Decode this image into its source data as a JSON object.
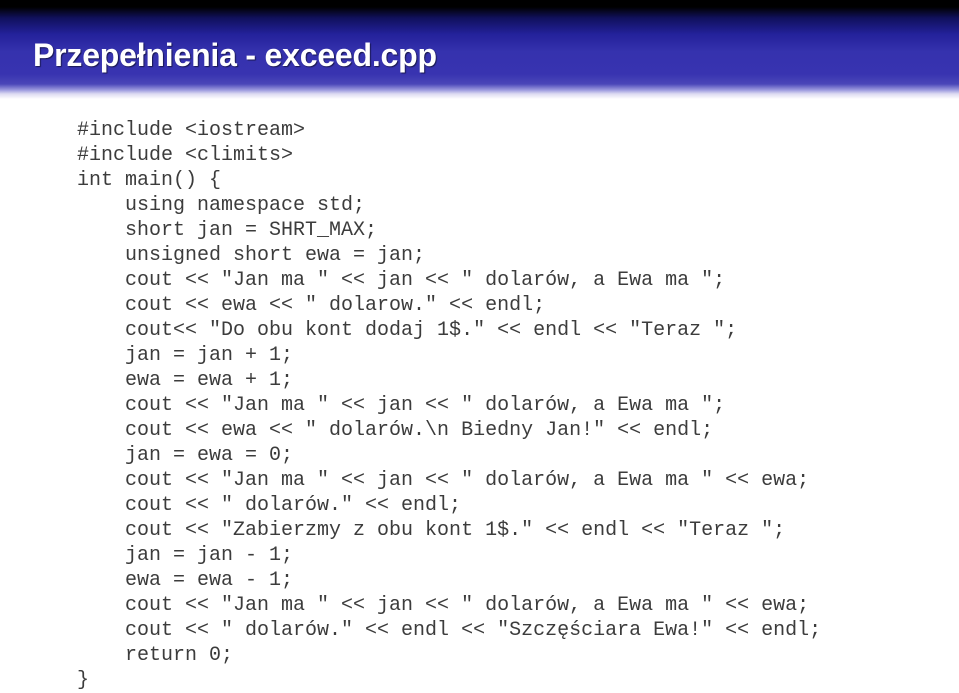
{
  "slide": {
    "title": "Przepełnienia - exceed.cpp",
    "accent_color": "#3833b0",
    "banner_top_color": "#000000",
    "banner_bottom_color": "#ffffff",
    "code_text_color": "#3c3c3c",
    "background_color": "#ffffff"
  },
  "code": {
    "language": "cpp",
    "lines": [
      "#include <iostream>",
      "#include <climits>",
      "int main() {",
      "    using namespace std;",
      "    short jan = SHRT_MAX;",
      "    unsigned short ewa = jan;",
      "    cout << \"Jan ma \" << jan << \" dolarów, a Ewa ma \";",
      "    cout << ewa << \" dolarow.\" << endl;",
      "    cout<< \"Do obu kont dodaj 1$.\" << endl << \"Teraz \";",
      "    jan = jan + 1;",
      "    ewa = ewa + 1;",
      "    cout << \"Jan ma \" << jan << \" dolarów, a Ewa ma \";",
      "    cout << ewa << \" dolarów.\\n Biedny Jan!\" << endl;",
      "    jan = ewa = 0;",
      "    cout << \"Jan ma \" << jan << \" dolarów, a Ewa ma \" << ewa;",
      "    cout << \" dolarów.\" << endl;",
      "    cout << \"Zabierzmy z obu kont 1$.\" << endl << \"Teraz \";",
      "    jan = jan - 1;",
      "    ewa = ewa - 1;",
      "    cout << \"Jan ma \" << jan << \" dolarów, a Ewa ma \" << ewa;",
      "    cout << \" dolarów.\" << endl << \"Szczęściara Ewa!\" << endl;",
      "    return 0;",
      "}"
    ]
  }
}
